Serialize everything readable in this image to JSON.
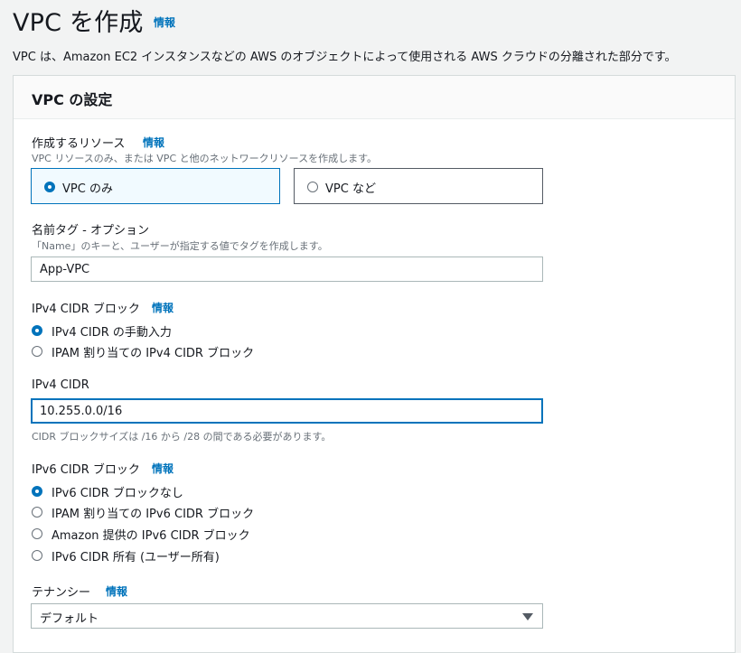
{
  "page": {
    "title": "VPC を作成",
    "title_info": "情報",
    "description": "VPC は、Amazon EC2 インスタンスなどの AWS のオブジェクトによって使用される AWS クラウドの分離された部分です。"
  },
  "panel": {
    "title": "VPC の設定"
  },
  "resources": {
    "label": "作成するリソース",
    "info": "情報",
    "description": "VPC リソースのみ、または VPC と他のネットワークリソースを作成します。",
    "options": [
      {
        "label": "VPC のみ",
        "selected": true
      },
      {
        "label": "VPC など",
        "selected": false
      }
    ]
  },
  "name_tag": {
    "label": "名前タグ - オプション",
    "description": "「Name」のキーと、ユーザーが指定する値でタグを作成します。",
    "value": "App-VPC"
  },
  "ipv4_block": {
    "label": "IPv4 CIDR ブロック",
    "info": "情報",
    "options": [
      {
        "label": "IPv4 CIDR の手動入力",
        "selected": true
      },
      {
        "label": "IPAM 割り当ての IPv4 CIDR ブロック",
        "selected": false
      }
    ]
  },
  "ipv4_cidr": {
    "label": "IPv4 CIDR",
    "value": "10.255.0.0/16",
    "hint": "CIDR ブロックサイズは /16 から /28 の間である必要があります。"
  },
  "ipv6_block": {
    "label": "IPv6 CIDR ブロック",
    "info": "情報",
    "options": [
      {
        "label": "IPv6 CIDR ブロックなし",
        "selected": true
      },
      {
        "label": "IPAM 割り当ての IPv6 CIDR ブロック",
        "selected": false
      },
      {
        "label": "Amazon 提供の IPv6 CIDR ブロック",
        "selected": false
      },
      {
        "label": "IPv6 CIDR 所有 (ユーザー所有)",
        "selected": false
      }
    ]
  },
  "tenancy": {
    "label": "テナンシー",
    "info": "情報",
    "value": "デフォルト"
  },
  "colors": {
    "accent": "#0073bb",
    "text": "#16191f",
    "secondary_text": "#687078",
    "background": "#f2f3f3"
  }
}
